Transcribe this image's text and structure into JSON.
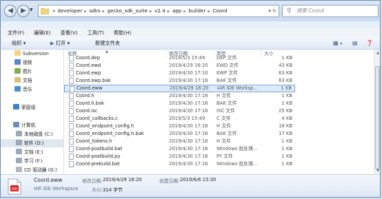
{
  "address": {
    "crumbs": [
      "«",
      "developer",
      "sdks",
      "gecko_sdk_suite",
      "v2.4",
      "app",
      "builder",
      "Coord"
    ],
    "search_placeholder": "搜索 Coord"
  },
  "menu": [
    "文件(F)",
    "编辑(E)",
    "查看(V)",
    "工具(T)",
    "帮助(H)"
  ],
  "toolbar": {
    "organize": "组织",
    "open": "打开",
    "new_folder": "新建文件夹"
  },
  "sidebar": {
    "items": [
      {
        "label": "Subversion",
        "icon": "folder-icon"
      },
      {
        "label": "视频",
        "icon": "video-library-icon"
      },
      {
        "label": "图片",
        "icon": "picture-library-icon"
      },
      {
        "label": "文档",
        "icon": "document-library-icon"
      },
      {
        "label": "音乐",
        "icon": "music-library-icon"
      },
      {
        "label": "家庭组",
        "icon": "homegroup-icon"
      },
      {
        "label": "计算机",
        "icon": "computer-icon"
      },
      {
        "label": "本地磁盘 (C:)",
        "icon": "drive-icon"
      },
      {
        "label": "软件 (D:)",
        "icon": "drive-icon"
      },
      {
        "label": "文档 (E:)",
        "icon": "drive-icon"
      },
      {
        "label": "学习 (F:)",
        "icon": "drive-icon"
      },
      {
        "label": "CD 驱动器 (G:)",
        "icon": "cd-drive-icon"
      }
    ]
  },
  "columns": {
    "name": "名称",
    "date": "修改日期",
    "type": "类型",
    "size": "大小"
  },
  "top_partial": {
    "name": "Coord.dep",
    "date": "2019/5/3 15:49",
    "type": "DEP 文件",
    "size": "1 KB"
  },
  "files": [
    {
      "name": "Coord.ewd",
      "date": "2019/4/29 16:20",
      "type": "EWD 文件",
      "size": "43 KB"
    },
    {
      "name": "Coord.ewp",
      "date": "2019/4/30 17:10",
      "type": "EWP 文件",
      "size": "63 KB"
    },
    {
      "name": "Coord.ewp.bak",
      "date": "2019/4/30 17:16",
      "type": "BAK 文件",
      "size": "63 KB"
    },
    {
      "name": "Coord.eww",
      "date": "2019/4/29 16:20",
      "type": "IAR IDE Worksp...",
      "size": "1 KB"
    },
    {
      "name": "Coord.h",
      "date": "2019/4/30 17:16",
      "type": "H 文件",
      "size": "1 KB"
    },
    {
      "name": "Coord.h.bak",
      "date": "2019/4/30 17:16",
      "type": "BAK 文件",
      "size": "1 KB"
    },
    {
      "name": "Coord.isc",
      "date": "2019/4/30 17:16",
      "type": "ISC 文件",
      "size": "25 KB"
    },
    {
      "name": "Coord_callbacks.c",
      "date": "2019/5/3 15:49",
      "type": "C 文件",
      "size": "4 KB"
    },
    {
      "name": "Coord_endpoint_config.h",
      "date": "2019/4/30 17:16",
      "type": "H 文件",
      "size": "18 KB"
    },
    {
      "name": "Coord_endpoint_config.h.bak",
      "date": "2019/4/30 17:16",
      "type": "BAK 文件",
      "size": "17 KB"
    },
    {
      "name": "Coord_tokens.h",
      "date": "2019/4/30 17:16",
      "type": "H 文件",
      "size": "1 KB"
    },
    {
      "name": "Coord-postbuild.bat",
      "date": "2019/4/30 17:16",
      "type": "Windows 批处理...",
      "size": "1 KB"
    },
    {
      "name": "Coord-postbuild.py",
      "date": "2019/4/30 17:16",
      "type": "PY 文件",
      "size": "1 KB"
    },
    {
      "name": "Coord-prebuild.bat",
      "date": "2019/4/30 17:16",
      "type": "Windows 批处理...",
      "size": "1 KB"
    }
  ],
  "details": {
    "name": "Coord.eww",
    "type": "IAR IDE Workspace",
    "modified_label": "修改日期:",
    "modified": "2019/4/29 16:20",
    "created_label": "创建日期:",
    "created": "2019/6/6 15:30",
    "size_label": "大小:",
    "size": "314 字节"
  }
}
